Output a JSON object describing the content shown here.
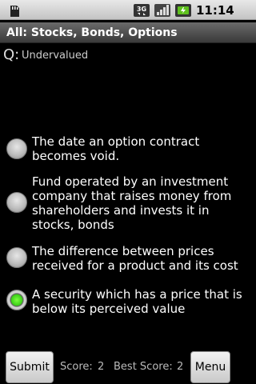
{
  "status_bar": {
    "time": "11:14 AM",
    "icons": [
      "sd-card-icon",
      "3g-network-icon",
      "signal-strength-icon",
      "battery-charging-icon"
    ]
  },
  "title_bar": {
    "title": "All: Stocks, Bonds, Options"
  },
  "question": {
    "prefix": "Q:",
    "text": "Undervalued"
  },
  "options": [
    {
      "text": "The date an option contract becomes void.",
      "selected": false
    },
    {
      "text": "Fund operated by an investment company that raises money from shareholders and invests it in stocks, bonds",
      "selected": false
    },
    {
      "text": "The difference between prices received for a product and its cost",
      "selected": false
    },
    {
      "text": "A security which has a price that is below its perceived value",
      "selected": true
    }
  ],
  "footer": {
    "submit_label": "Submit",
    "score_label": "Score:",
    "score_value": "2",
    "best_label": "Best Score:",
    "best_value": "2",
    "menu_label": "Menu"
  },
  "colors": {
    "selected_radio": "#3bcf17",
    "background": "#000000",
    "title_bar": "#4a4a4a"
  }
}
